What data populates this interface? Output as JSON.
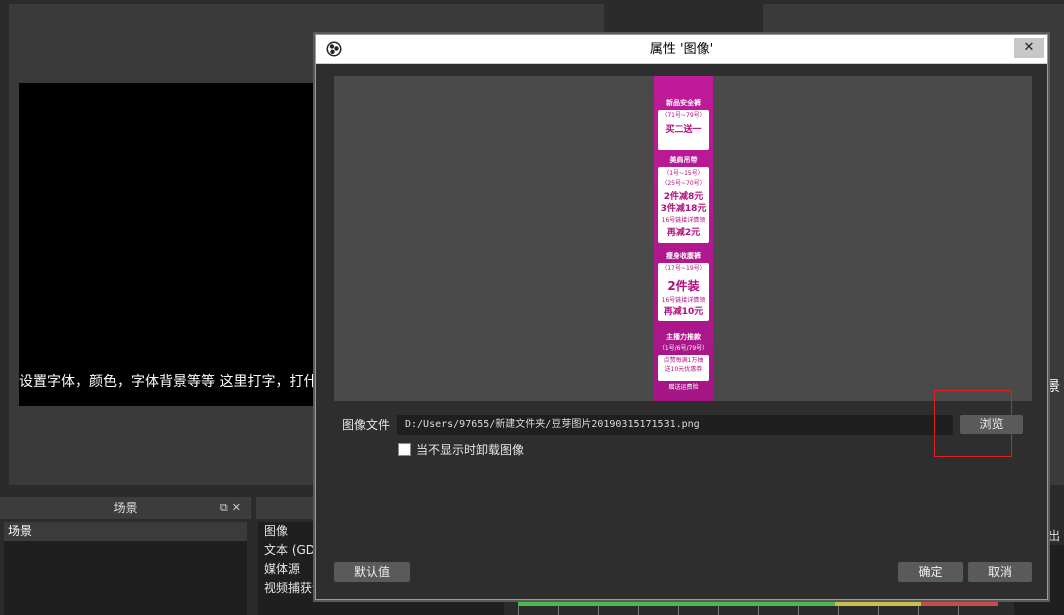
{
  "background": {
    "text_source_preview": "设置字体，颜色，字体背景等等 这里打字，打什么就显示什么",
    "right_edge_text": "景",
    "scenes_dock": {
      "title": "场景",
      "items": [
        "场景"
      ]
    },
    "sources_dock": {
      "items": [
        "图像",
        "文本 (GDI+)",
        "媒体源",
        "视频捕获设备"
      ]
    },
    "right_dock_label": "出"
  },
  "dialog": {
    "title": "属性 '图像'",
    "close_glyph": "✕",
    "image_file_label": "图像文件",
    "image_file_value": "D:/Users/97655/新建文件夹/豆芽图片20190315171531.png",
    "browse_label": "浏览",
    "unload_checkbox_label": "当不显示时卸载图像",
    "unload_checked": false,
    "defaults_label": "默认值",
    "ok_label": "确定",
    "cancel_label": "取消",
    "preview_promo": {
      "h1": "新品安全裤",
      "h1_sub": "（71号~79号）",
      "h1_big": "买二送一",
      "h2": "美肩吊带",
      "h2_sub1": "（1号~15号）",
      "h2_sub2": "（25号~70号）",
      "h2_big1": "2件减8元",
      "h2_big2": "3件减18元",
      "h2_note": "16号链接详情领",
      "h2_big3": "再减2元",
      "h3": "瘦身收腹裤",
      "h3_sub": "（17号~19号）",
      "h3_big": "2件装",
      "h3_note": "16号链接详情领",
      "h3_big2": "再减10元",
      "h4": "主播力推款",
      "h4_sub": "（1号/6号/79号）",
      "h4_line1": "点赞每满1万抽",
      "h4_line2": "送10元优惠券",
      "h4_footer": "赠送运费险"
    }
  },
  "colors": {
    "accent_highlight": "#e02020",
    "promo_magenta": "#b0107f"
  }
}
